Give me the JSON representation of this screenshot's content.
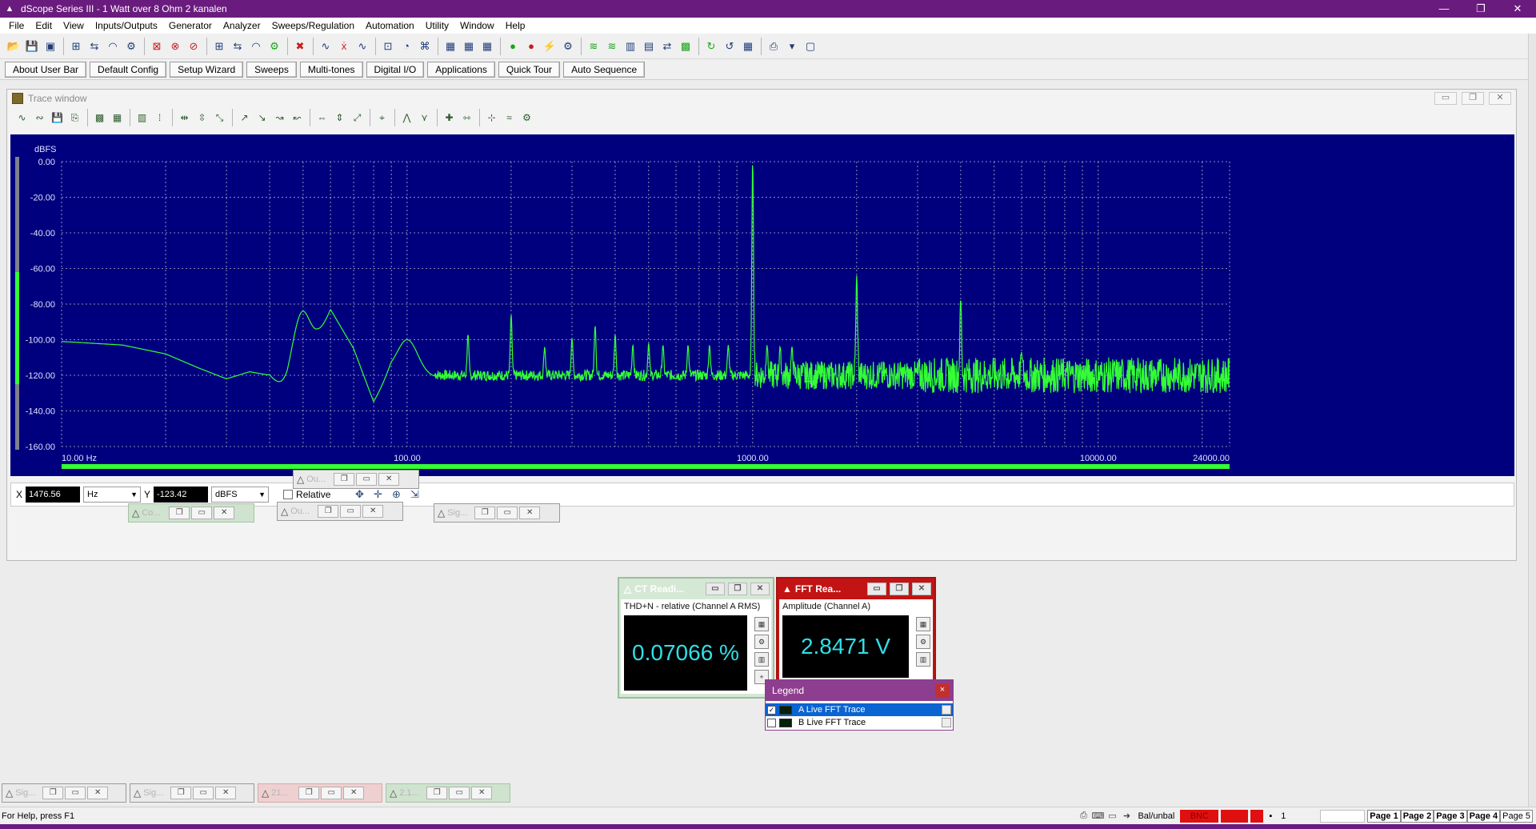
{
  "window": {
    "title": "dScope Series III - 1 Watt over 8 Ohm 2 kanalen",
    "controls": [
      "—",
      "❐",
      "✕"
    ]
  },
  "menu": [
    "File",
    "Edit",
    "View",
    "Inputs/Outputs",
    "Generator",
    "Analyzer",
    "Sweeps/Regulation",
    "Automation",
    "Utility",
    "Window",
    "Help"
  ],
  "user_bar": [
    "About User Bar",
    "Default Config",
    "Setup Wizard",
    "Sweeps",
    "Multi-tones",
    "Digital I/O",
    "Applications",
    "Quick Tour",
    "Auto Sequence"
  ],
  "trace_window": {
    "title": "Trace window",
    "cursor": {
      "x_label": "X",
      "x_value": "1476.56",
      "x_unit": "Hz",
      "y_label": "Y",
      "y_value": "-123.42",
      "y_unit": "dBFS",
      "relative_label": "Relative"
    }
  },
  "chart_data": {
    "type": "line",
    "title": "",
    "ylabel": "dBFS",
    "xlabel": "",
    "x_scale": "log",
    "xlim": [
      10,
      24000
    ],
    "ylim": [
      -160,
      0
    ],
    "x_tick_labels": [
      "10.00 Hz",
      "100.00",
      "1000.00",
      "10000.00",
      "24000.00"
    ],
    "y_tick_labels": [
      "0.00",
      "-20.00",
      "-40.00",
      "-60.00",
      "-80.00",
      "-100.00",
      "-120.00",
      "-140.00",
      "-160.00"
    ],
    "grid": true,
    "series": [
      {
        "color": "#33ff33",
        "noise_floor_db": -120,
        "baseline": {
          "x": [
            10,
            15,
            20,
            25,
            30,
            35,
            40,
            45,
            50,
            55,
            60,
            70,
            80,
            90,
            100,
            120,
            150,
            200
          ],
          "y": [
            -101,
            -103,
            -108,
            -116,
            -122,
            -118,
            -120,
            -132,
            -125,
            -100,
            -83,
            -105,
            -135,
            -118,
            -120,
            -121,
            -120,
            -120
          ]
        },
        "peaks": [
          {
            "x": 50,
            "y": -84
          },
          {
            "x": 100,
            "y": -100
          },
          {
            "x": 150,
            "y": -97
          },
          {
            "x": 200,
            "y": -86
          },
          {
            "x": 250,
            "y": -104
          },
          {
            "x": 300,
            "y": -99
          },
          {
            "x": 350,
            "y": -92
          },
          {
            "x": 400,
            "y": -97
          },
          {
            "x": 450,
            "y": -103
          },
          {
            "x": 500,
            "y": -102
          },
          {
            "x": 550,
            "y": -103
          },
          {
            "x": 650,
            "y": -103
          },
          {
            "x": 750,
            "y": -103
          },
          {
            "x": 850,
            "y": -103
          },
          {
            "x": 1000,
            "y": 0
          },
          {
            "x": 1100,
            "y": -103
          },
          {
            "x": 1200,
            "y": -104
          },
          {
            "x": 1300,
            "y": -104
          },
          {
            "x": 2000,
            "y": -64
          },
          {
            "x": 4000,
            "y": -77
          },
          {
            "x": 6000,
            "y": -107
          }
        ]
      }
    ]
  },
  "minimized_windows_mid": [
    {
      "label": "Ou...",
      "style": "plain"
    },
    {
      "label": "Co...",
      "style": "greenish"
    },
    {
      "label": "Ou...",
      "style": "plain"
    },
    {
      "label": "Sig...",
      "style": "plain"
    }
  ],
  "minimized_windows_bottom": [
    {
      "label": "Sig...",
      "style": "plain"
    },
    {
      "label": "Sig...",
      "style": "plain"
    },
    {
      "label": "21...",
      "style": "pink"
    },
    {
      "label": "2.1...",
      "style": "greenish"
    }
  ],
  "readings": [
    {
      "title": "CT Readi...",
      "description": "THD+N - relative (Channel A RMS)",
      "value": "0.07066 %"
    },
    {
      "title": "FFT Rea...",
      "description": "Amplitude (Channel A)",
      "value": "2.8471 V"
    }
  ],
  "legend": {
    "title": "Legend",
    "items": [
      {
        "label": "A Live FFT Trace",
        "checked": "✓"
      },
      {
        "label": "B Live FFT Trace",
        "checked": ""
      }
    ]
  },
  "status": {
    "help": "For Help, press F1",
    "bal": "Bal/unbal",
    "bnc": "BNC",
    "count": "1",
    "pages": [
      "Page 1",
      "Page 2",
      "Page 3",
      "Page 4",
      "Page 5"
    ]
  },
  "colors": {
    "titlebar": "#6a1b7e",
    "plot_background": "#00007f",
    "trace": "#33ff33",
    "reading_text": "#2fe0e8"
  }
}
